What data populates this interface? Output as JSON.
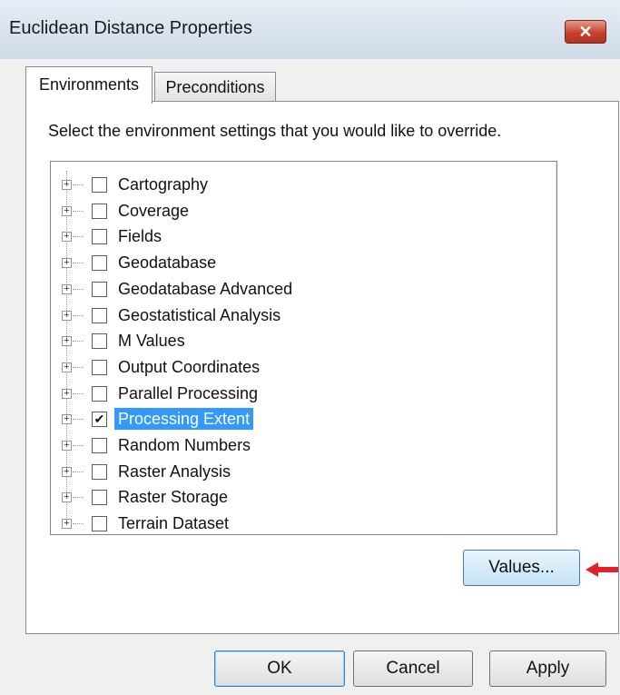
{
  "window": {
    "title": "Euclidean Distance Properties",
    "close_glyph": "✕"
  },
  "tabs": [
    {
      "label": "Environments",
      "active": true
    },
    {
      "label": "Preconditions",
      "active": false
    }
  ],
  "instruction": "Select the environment settings that you would like to override.",
  "tree": {
    "expand_glyph": "+",
    "check_glyph": "✔",
    "items": [
      {
        "label": "Cartography",
        "checked": false,
        "selected": false
      },
      {
        "label": "Coverage",
        "checked": false,
        "selected": false
      },
      {
        "label": "Fields",
        "checked": false,
        "selected": false
      },
      {
        "label": "Geodatabase",
        "checked": false,
        "selected": false
      },
      {
        "label": "Geodatabase Advanced",
        "checked": false,
        "selected": false
      },
      {
        "label": "Geostatistical Analysis",
        "checked": false,
        "selected": false
      },
      {
        "label": "M Values",
        "checked": false,
        "selected": false
      },
      {
        "label": "Output Coordinates",
        "checked": false,
        "selected": false
      },
      {
        "label": "Parallel Processing",
        "checked": false,
        "selected": false
      },
      {
        "label": "Processing Extent",
        "checked": true,
        "selected": true
      },
      {
        "label": "Random Numbers",
        "checked": false,
        "selected": false
      },
      {
        "label": "Raster Analysis",
        "checked": false,
        "selected": false
      },
      {
        "label": "Raster Storage",
        "checked": false,
        "selected": false
      },
      {
        "label": "Terrain Dataset",
        "checked": false,
        "selected": false
      }
    ]
  },
  "scrollbar": {
    "up_glyph": "▲",
    "down_glyph": "▼",
    "grip_glyph": "≡"
  },
  "buttons": {
    "values": "Values...",
    "ok": "OK",
    "cancel": "Cancel",
    "apply": "Apply"
  },
  "colors": {
    "selection": "#3399ff",
    "annotation_arrow": "#e0202a"
  }
}
